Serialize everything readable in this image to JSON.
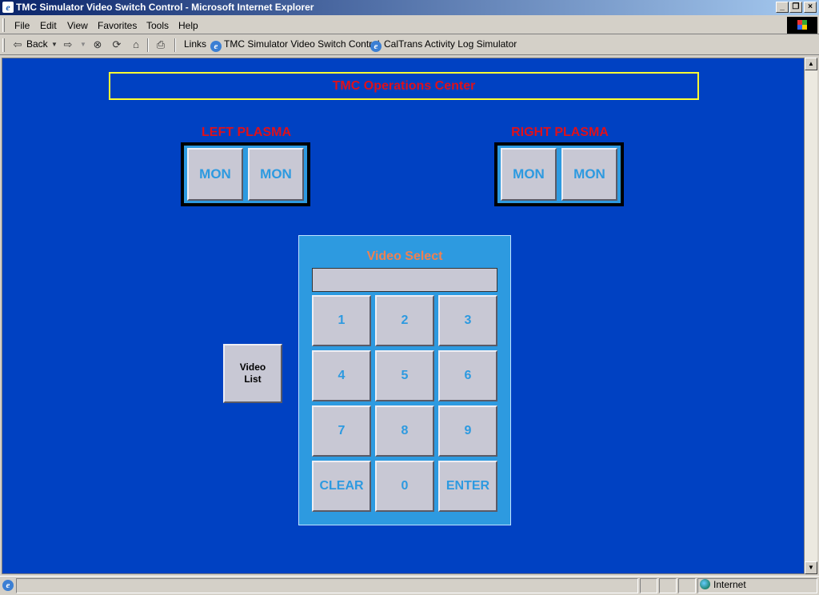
{
  "window": {
    "title": "TMC Simulator Video Switch Control - Microsoft Internet Explorer"
  },
  "menu": {
    "items": [
      "File",
      "Edit",
      "View",
      "Favorites",
      "Tools",
      "Help"
    ]
  },
  "toolbar": {
    "back_label": "Back",
    "links_label": "Links",
    "links": [
      "TMC Simulator Video Switch Control",
      "CalTrans Activity Log Simulator"
    ]
  },
  "page": {
    "banner": "TMC Operations Center",
    "left_plasma": {
      "label": "LEFT PLASMA",
      "monitors": [
        "MON",
        "MON"
      ]
    },
    "right_plasma": {
      "label": "RIGHT PLASMA",
      "monitors": [
        "MON",
        "MON"
      ]
    },
    "video_list_button": "Video\nList",
    "keypad": {
      "title": "Video Select",
      "display_value": "",
      "keys": [
        "1",
        "2",
        "3",
        "4",
        "5",
        "6",
        "7",
        "8",
        "9",
        "CLEAR",
        "0",
        "ENTER"
      ]
    }
  },
  "status": {
    "zone": "Internet"
  },
  "colors": {
    "page_bg": "#0041c2",
    "accent_red": "#e0101a",
    "accent_blue": "#2d9ae0",
    "banner_border": "#ffff33",
    "keypad_title": "#f08050"
  }
}
